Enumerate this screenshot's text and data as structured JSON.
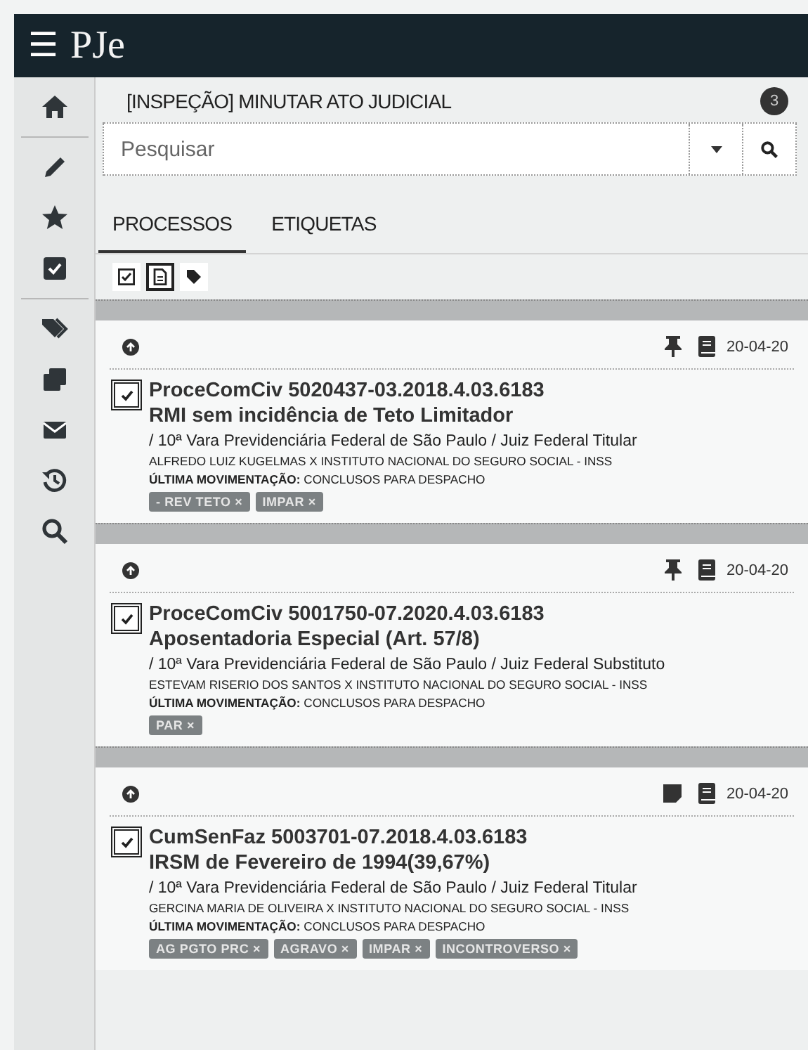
{
  "topbar": {
    "menu": "☰",
    "logo": "PJe"
  },
  "header": {
    "title": "[INSPEÇÃO] MINUTAR ATO JUDICIAL",
    "badge": "3"
  },
  "search": {
    "placeholder": "Pesquisar"
  },
  "tabs": [
    {
      "label": "PROCESSOS",
      "selected": true
    },
    {
      "label": "ETIQUETAS",
      "selected": false
    }
  ],
  "toolbar": [
    {
      "kind": "check",
      "checked": true
    },
    {
      "kind": "document",
      "selected": true
    },
    {
      "kind": "tag",
      "selected": false
    }
  ],
  "cards": [
    {
      "kind": "pin",
      "date": "20-04-20",
      "checked": true,
      "number": "ProceComCiv 5020437-03.2018.4.03.6183",
      "subject": "RMI sem incidência de Teto Limitador",
      "court": "/ 10ª Vara Previdenciária Federal de São Paulo / Juiz Federal Titular",
      "parties": "ALFREDO LUIZ KUGELMAS X INSTITUTO NACIONAL DO SEGURO SOCIAL - INSS",
      "movement_label": "ÚLTIMA MOVIMENTAÇÃO:",
      "movement": "CONCLUSOS PARA DESPACHO",
      "tags": [
        {
          "label": "- REV TETO",
          "remove": "×"
        },
        {
          "label": "IMPAR",
          "remove": "×"
        }
      ]
    },
    {
      "kind": "pin",
      "date": "20-04-20",
      "checked": true,
      "number": "ProceComCiv 5001750-07.2020.4.03.6183",
      "subject": "Aposentadoria Especial (Art. 57/8)",
      "court": "/ 10ª Vara Previdenciária Federal de São Paulo / Juiz Federal Substituto",
      "parties": "ESTEVAM RISERIO DOS SANTOS X INSTITUTO NACIONAL DO SEGURO SOCIAL - INSS",
      "movement_label": "ÚLTIMA MOVIMENTAÇÃO:",
      "movement": "CONCLUSOS PARA DESPACHO",
      "tags": [
        {
          "label": "PAR",
          "remove": "×"
        }
      ]
    },
    {
      "kind": "note",
      "date": "20-04-20",
      "checked": true,
      "number": "CumSenFaz 5003701-07.2018.4.03.6183",
      "subject": "IRSM de Fevereiro de 1994(39,67%)",
      "court": "/ 10ª Vara Previdenciária Federal de São Paulo / Juiz Federal Titular",
      "parties": "GERCINA MARIA DE OLIVEIRA X INSTITUTO NACIONAL DO SEGURO SOCIAL - INSS",
      "movement_label": "ÚLTIMA MOVIMENTAÇÃO:",
      "movement": "CONCLUSOS PARA DESPACHO",
      "tags": [
        {
          "label": "AG PGTO PRC",
          "remove": "×"
        },
        {
          "label": "AGRAVO",
          "remove": "×"
        },
        {
          "label": "IMPAR",
          "remove": "×"
        },
        {
          "label": "INCONTROVERSO",
          "remove": "×"
        }
      ]
    }
  ]
}
